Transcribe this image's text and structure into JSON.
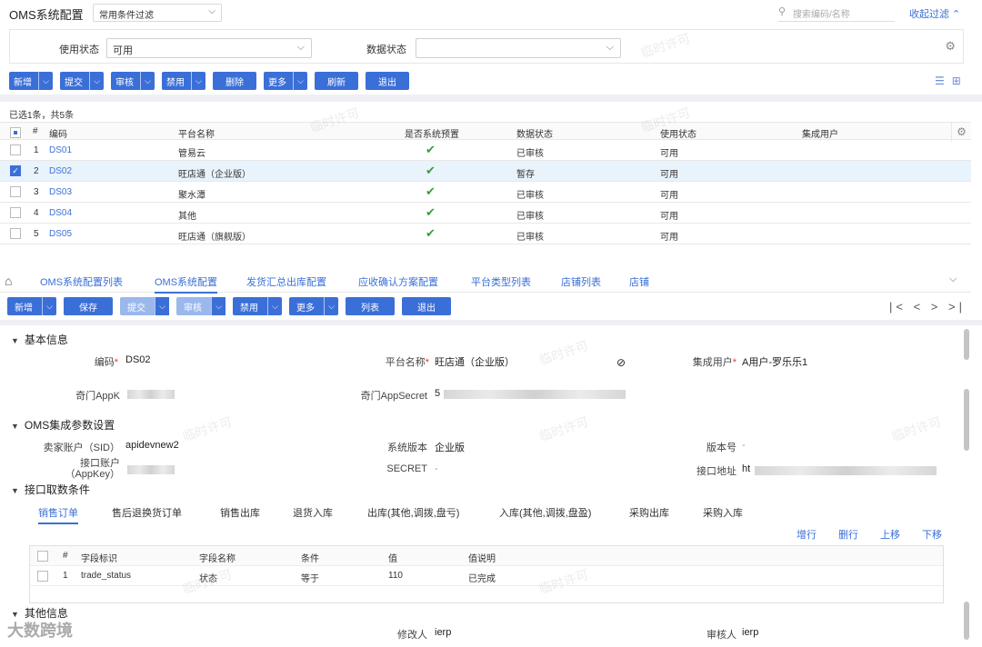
{
  "header": {
    "title": "OMS系统配置",
    "filter_select": "常用条件过滤",
    "search_placeholder": "搜索编码/名称",
    "collapse_filter": "收起过滤"
  },
  "filters": {
    "usage_status_label": "使用状态",
    "usage_status_value": "可用",
    "data_status_label": "数据状态",
    "data_status_value": ""
  },
  "toolbar1": {
    "new": "新增",
    "submit": "提交",
    "audit": "审核",
    "disable": "禁用",
    "delete": "删除",
    "more": "更多",
    "refresh": "刷新",
    "exit": "退出"
  },
  "list": {
    "selection_info": "已选1条，共5条",
    "columns": [
      "#",
      "编码",
      "平台名称",
      "是否系统预置",
      "数据状态",
      "使用状态",
      "集成用户"
    ],
    "rows": [
      {
        "num": "1",
        "code": "DS01",
        "platform": "管易云",
        "preset": "✔",
        "data_status": "已审核",
        "usage": "可用",
        "user": ""
      },
      {
        "num": "2",
        "code": "DS02",
        "platform": "旺店通（企业版）",
        "preset": "✔",
        "data_status": "暂存",
        "usage": "可用",
        "user": ""
      },
      {
        "num": "3",
        "code": "DS03",
        "platform": "聚水潭",
        "preset": "✔",
        "data_status": "已审核",
        "usage": "可用",
        "user": ""
      },
      {
        "num": "4",
        "code": "DS04",
        "platform": "其他",
        "preset": "✔",
        "data_status": "已审核",
        "usage": "可用",
        "user": ""
      },
      {
        "num": "5",
        "code": "DS05",
        "platform": "旺店通（旗舰版）",
        "preset": "✔",
        "data_status": "已审核",
        "usage": "可用",
        "user": ""
      }
    ]
  },
  "tabs": [
    "OMS系统配置列表",
    "OMS系统配置",
    "发货汇总出库配置",
    "应收确认方案配置",
    "平台类型列表",
    "店铺列表",
    "店铺"
  ],
  "toolbar2": {
    "new": "新增",
    "save": "保存",
    "submit": "提交",
    "audit": "审核",
    "disable": "禁用",
    "more": "更多",
    "list": "列表",
    "exit": "退出"
  },
  "pager": "|< < > >|",
  "basic": {
    "title": "基本信息",
    "code_label": "编码",
    "code_value": "DS02",
    "platform_label": "平台名称",
    "platform_value": "旺店通（企业版）",
    "user_label": "集成用户",
    "user_value": "A用户-罗乐乐1",
    "appkey_label": "奇门AppK",
    "appsecret_label": "奇门AppSecret",
    "appsecret_prefix": "5"
  },
  "oms_params": {
    "title": "OMS集成参数设置",
    "sid_label": "卖家账户（SID）",
    "sid_value": "apidevnew2",
    "version_label": "系统版本",
    "version_value": "企业版",
    "version_no_label": "版本号",
    "version_no_value": "-",
    "api_account_label": "接口账户（AppKey）",
    "secret_label": "SECRET",
    "secret_value": "-",
    "api_url_label": "接口地址",
    "api_url_prefix": "ht"
  },
  "fetch_conditions": {
    "title": "接口取数条件",
    "subtabs": [
      "销售订单",
      "售后退换货订单",
      "销售出库",
      "退货入库",
      "出库(其他,调拨,盘亏)",
      "入库(其他,调拨,盘盈)",
      "采购出库",
      "采购入库"
    ],
    "actions": [
      "增行",
      "删行",
      "上移",
      "下移"
    ],
    "columns": [
      "#",
      "字段标识",
      "字段名称",
      "条件",
      "值",
      "值说明"
    ],
    "rows": [
      {
        "num": "1",
        "field_id": "trade_status",
        "field_name": "状态",
        "condition": "等于",
        "value": "110",
        "desc": "已完成"
      }
    ]
  },
  "other": {
    "title": "其他信息",
    "modifier_label": "修改人",
    "modifier_value": "ierp",
    "auditor_label": "审核人",
    "auditor_value": "ierp"
  },
  "watermark": "临时许可",
  "corner_logo": "大数跨境"
}
